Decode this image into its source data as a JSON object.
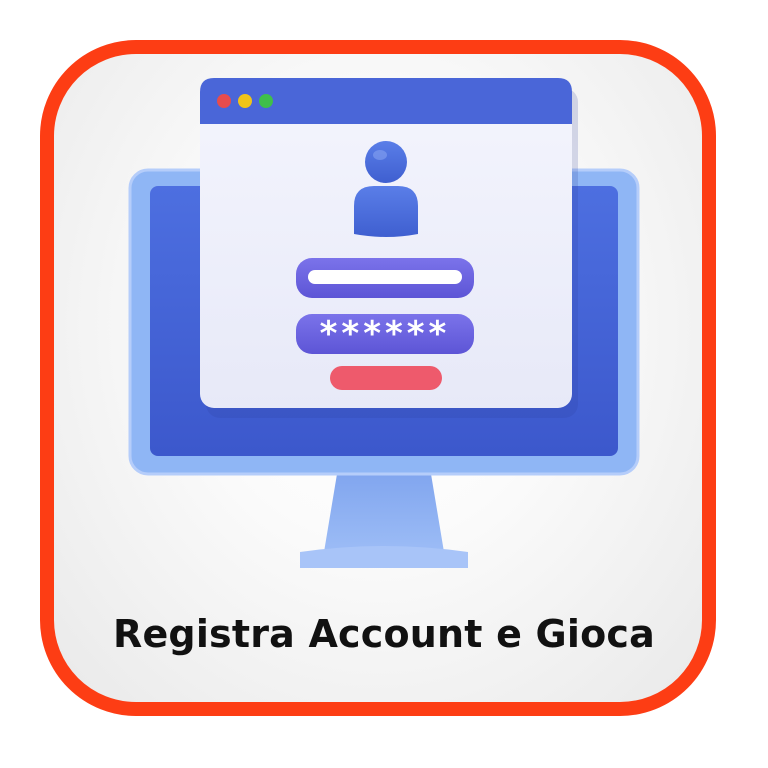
{
  "caption": "Registra Account e Gioca",
  "login_form": {
    "password_mask": "******"
  },
  "colors": {
    "frame_border": "#fd3d14",
    "monitor_bezel": "#8fb6f5",
    "monitor_screen": "#4361d6",
    "window_titlebar": "#4a66d8",
    "window_body": "#eef0fb",
    "input_fill": "#6b64e0",
    "submit_button": "#ee5a6c",
    "traffic_red": "#e74c4c",
    "traffic_yellow": "#f0c419",
    "traffic_green": "#3fbf4a"
  },
  "icons": [
    "user-avatar-icon"
  ]
}
